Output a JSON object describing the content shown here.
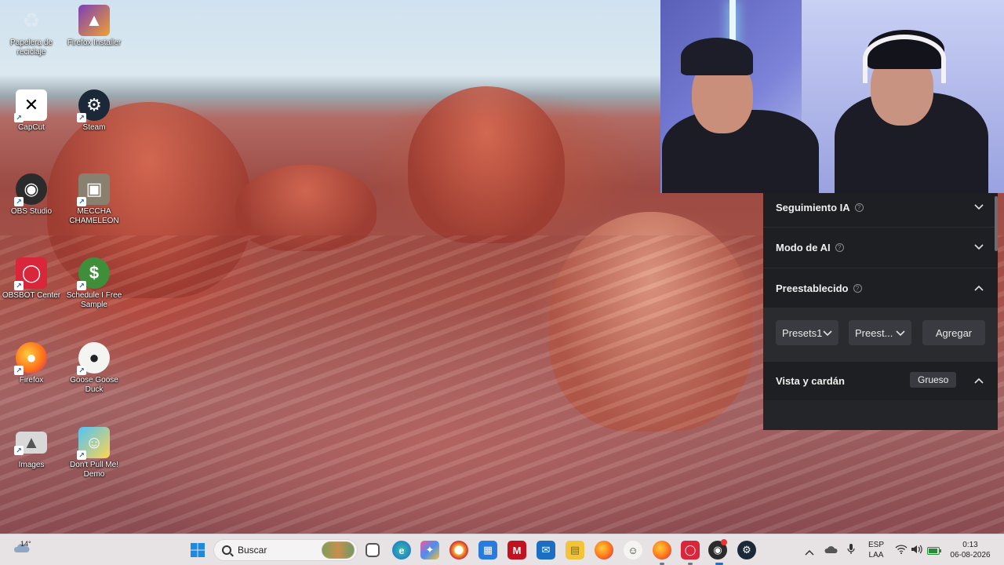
{
  "desktop": {
    "icons": [
      {
        "label": "Papelera de reciclaje",
        "icon": "recycle-bin-icon"
      },
      {
        "label": "Firefox Installer",
        "icon": "firefox-installer-icon"
      },
      {
        "label": "CapCut",
        "icon": "capcut-icon"
      },
      {
        "label": "Steam",
        "icon": "steam-icon"
      },
      {
        "label": "OBS Studio",
        "icon": "obs-studio-icon"
      },
      {
        "label": "MECCHA CHAMELEON",
        "icon": "meccha-chameleon-icon"
      },
      {
        "label": "OBSBOT Center",
        "icon": "obsbot-center-icon"
      },
      {
        "label": "Schedule I Free Sample",
        "icon": "schedule-i-icon"
      },
      {
        "label": "Firefox",
        "icon": "firefox-icon"
      },
      {
        "label": "Goose Goose Duck",
        "icon": "goose-goose-duck-icon"
      },
      {
        "label": "Images",
        "icon": "images-folder-icon"
      },
      {
        "label": "Don't Pull Me! Demo",
        "icon": "dont-pull-me-icon"
      }
    ]
  },
  "panel": {
    "rows": {
      "ai_tracking": "Seguimiento IA",
      "ai_mode": "Modo de AI",
      "preset": "Preestablecido",
      "view_gimbal": "Vista y cardán"
    },
    "preset_select_1": "Presets1",
    "preset_select_2": "Preest...",
    "add_button": "Agregar",
    "view_mode_tag": "Grueso"
  },
  "taskbar": {
    "weather_temp": "14°",
    "search_placeholder": "Buscar",
    "language": "ESP",
    "language_sub": "LAA",
    "time": "0:13",
    "date": "06-08-2026"
  },
  "colors": {
    "panel_bg": "#1e1f22",
    "taskbar_bg": "#e7e2e4"
  }
}
